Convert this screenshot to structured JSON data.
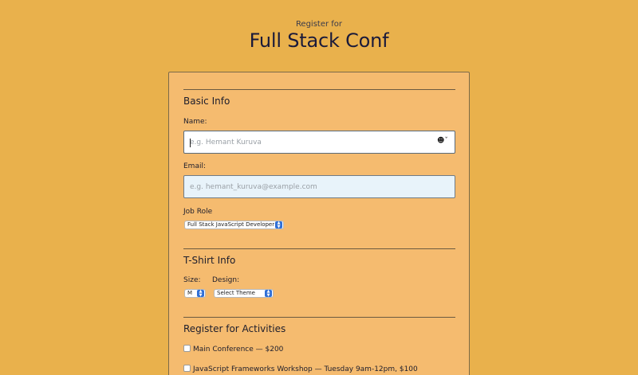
{
  "header": {
    "kicker": "Register for",
    "title": "Full Stack Conf"
  },
  "basic_info": {
    "section_title": "Basic Info",
    "name_label": "Name:",
    "name_placeholder": "e.g. Hemant Kuruva",
    "name_value": "",
    "email_label": "Email:",
    "email_placeholder": "e.g. hemant_kuruva@example.com",
    "email_value": "",
    "job_role_label": "Job Role",
    "job_role_selected": "Full Stack JavaScript Developer"
  },
  "tshirt_info": {
    "section_title": "T-Shirt Info",
    "size_label": "Size:",
    "size_selected": "M",
    "design_label": "Design:",
    "design_selected": "Select Theme"
  },
  "activities": {
    "section_title": "Register for Activities",
    "items": [
      {
        "label": "Main Conference — $200",
        "checked": false
      },
      {
        "label": "JavaScript Frameworks Workshop — Tuesday 9am-12pm, $100",
        "checked": false
      }
    ]
  },
  "icons": {
    "autofill": "contact-autofill-icon",
    "select_arrows": "select-arrows-icon"
  },
  "colors": {
    "page_background": "#e9b14c",
    "card_background": "#f5bb6f",
    "select_accent": "#2f6fd6",
    "email_field_background": "#e8f3fa"
  }
}
